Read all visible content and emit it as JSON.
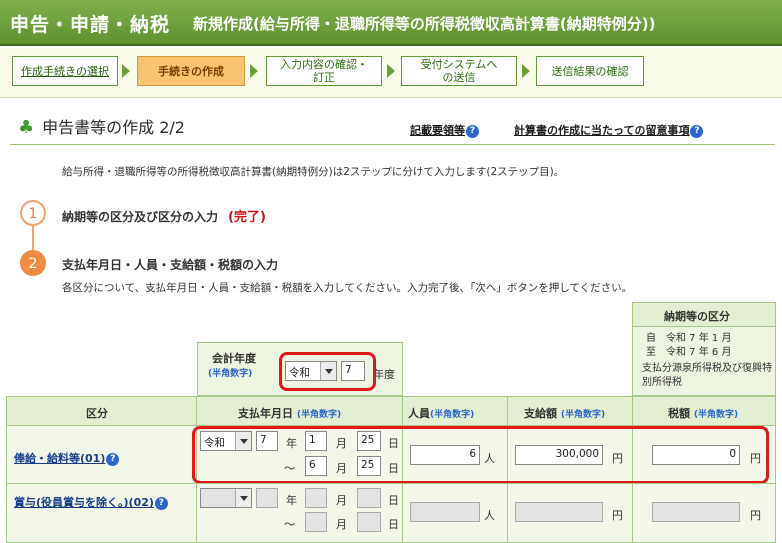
{
  "header": {
    "title": "申告・申請・納税",
    "subtitle": "新規作成(給与所得・退職所得等の所得税徴収高計算書(納期特例分))"
  },
  "steps": [
    {
      "label": "作成手続きの選択"
    },
    {
      "label": "手続きの作成"
    },
    {
      "label": "入力内容の確認・訂正"
    },
    {
      "label": "受付システムへの送信"
    },
    {
      "label": "送信結果の確認"
    }
  ],
  "page": {
    "title": "申告書等の作成 2/2",
    "link_guide": "記載要領等",
    "link_notes": "計算書の作成に当たっての留意事項",
    "help_icon": "?",
    "intro": "給与所得・退職所得等の所得税徴収高計算書(納期特例分)は2ステップに分けて入力します(2ステップ目)。"
  },
  "section1": {
    "number": "1",
    "title": "納期等の区分及び区分の入力",
    "status": "(完了)"
  },
  "section2": {
    "number": "2",
    "title": "支払年月日・人員・支給額・税額の入力",
    "desc": "各区分について、支払年月日・人員・支給額・税額を入力してください。入力完了後、「次へ」ボタンを押してください。"
  },
  "fiscal": {
    "label": "会計年度",
    "hint": "(半角数字)",
    "era": "令和",
    "year": "7",
    "suffix": "年度"
  },
  "period_box": {
    "title": "納期等の区分",
    "from_prefix": "自",
    "from": "令和 7 年 1 月",
    "to_prefix": "至",
    "to": "令和 7 年 6 月",
    "note": "支払分源泉所得税及び復興特別所得税"
  },
  "table": {
    "col_kubun": "区分",
    "col_date": "支払年月日",
    "col_people": "人員",
    "col_amount": "支給額",
    "col_tax": "税額",
    "hint": "(半角数字)",
    "unit_year": "年",
    "unit_month": "月",
    "unit_day": "日",
    "unit_person": "人",
    "unit_yen": "円",
    "tilde": "～"
  },
  "rows": [
    {
      "label": "俸給・給料等(01)",
      "era": "令和",
      "year": "7",
      "from_month": "1",
      "from_day": "25",
      "to_month": "6",
      "to_day": "25",
      "people": "6",
      "amount": "300,000",
      "tax": "0"
    },
    {
      "label": "賞与(役員賞与を除く。)(02)",
      "era": "",
      "year": "",
      "from_month": "",
      "from_day": "",
      "to_month": "",
      "to_day": "",
      "people": "",
      "amount": "",
      "tax": ""
    }
  ]
}
